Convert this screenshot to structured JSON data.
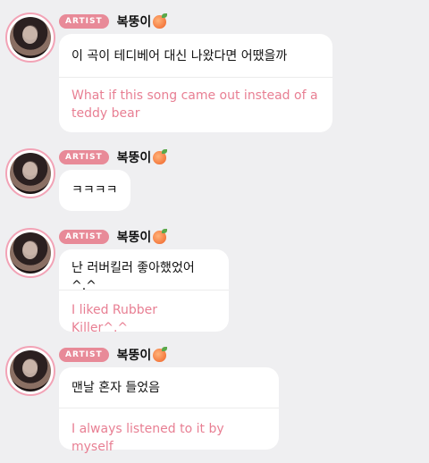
{
  "messages": [
    {
      "badge": "ARTIST",
      "name": "복뚱이",
      "korean": "이 곡이 테디베어 대신 나왔다면 어땠을까",
      "english": "What if this song came out instead of a teddy bear"
    },
    {
      "badge": "ARTIST",
      "name": "복뚱이",
      "korean": "ㅋㅋㅋㅋ",
      "english": ""
    },
    {
      "badge": "ARTIST",
      "name": "복뚱이",
      "korean": "난 러버킬러 좋아했었어^.^",
      "english": "I liked Rubber Killer^.^"
    },
    {
      "badge": "ARTIST",
      "name": "복뚱이",
      "korean": "맨날 혼자 들었음",
      "english": "I always listened to it by myself"
    }
  ],
  "icons": {
    "avatar": "profile-photo",
    "emoji": "peach-emoji"
  },
  "colors": {
    "background": "#efeff1",
    "badge": "#e88a98",
    "translation": "#e87f93",
    "avatar_ring": "#f2a3b6"
  }
}
